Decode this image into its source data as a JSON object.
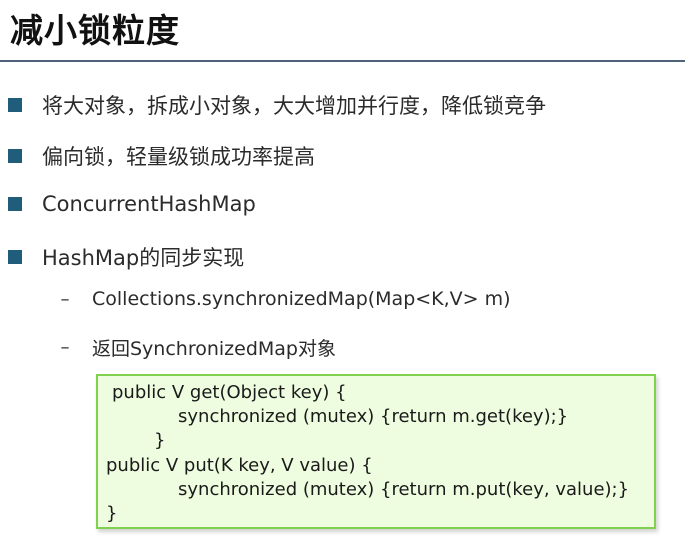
{
  "slide": {
    "title": "减小锁粒度",
    "bullets": [
      "将大对象，拆成小对象，大大增加并行度，降低锁竞争",
      "偏向锁，轻量级锁成功率提高",
      "ConcurrentHashMap",
      "HashMap的同步实现"
    ],
    "sub_bullets": [
      "Collections.synchronizedMap(Map<K,V>  m)",
      "返回SynchronizedMap对象"
    ],
    "code": [
      "public V get(Object key) {",
      "synchronized (mutex) {return m.get(key);}",
      "}",
      "public V put(K key, V value) {",
      "synchronized (mutex) {return m.put(key, value);}",
      "}"
    ],
    "colors": {
      "bullet": "#1f5d7a",
      "rule": "#4f6378",
      "code_bg": "#eefcdf",
      "code_border": "#7fd14f"
    }
  }
}
